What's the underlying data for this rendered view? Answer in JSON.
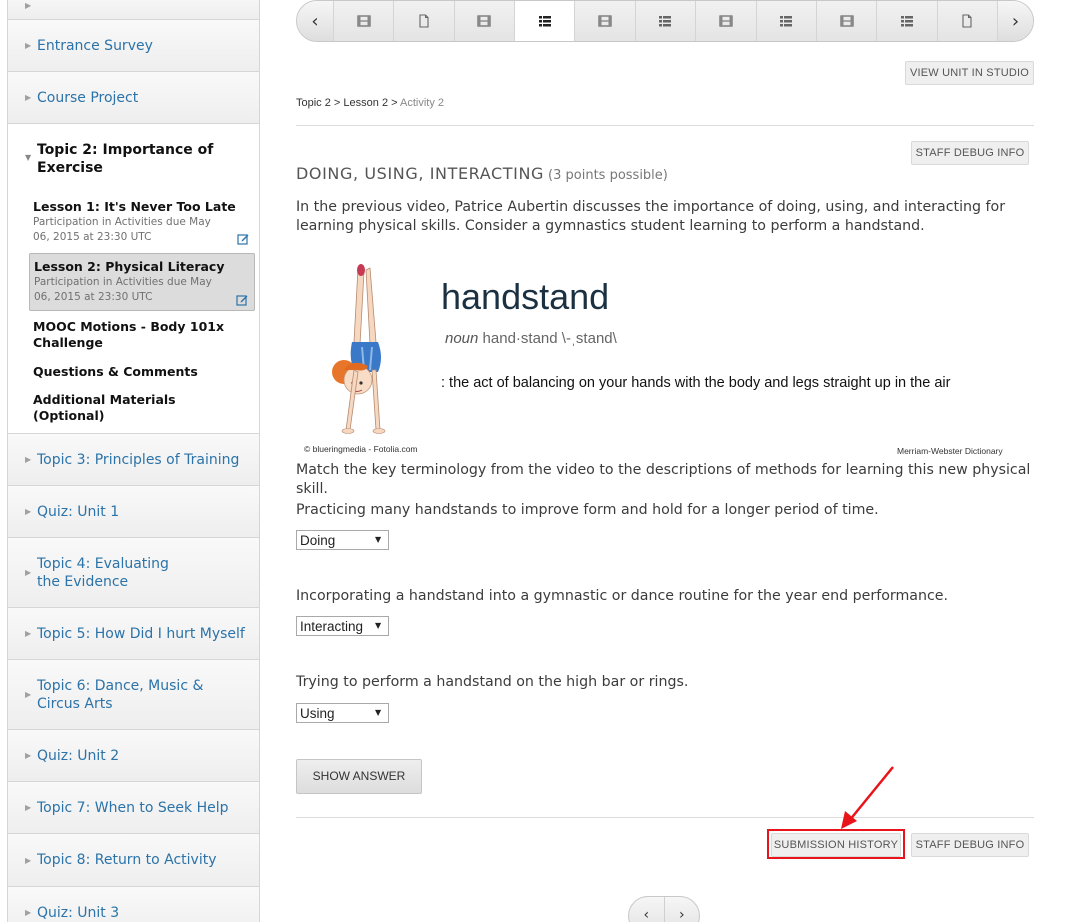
{
  "sidebar": {
    "items_top": [
      {
        "label": "Entrance Survey"
      },
      {
        "label": "Course Project"
      }
    ],
    "active_topic": {
      "title": "Topic 2: Importance of Exercise",
      "lessons": [
        {
          "title": "Lesson 1: It's Never Too Late",
          "due": "Participation in Activities due May 06, 2015 at 23:30 UTC"
        },
        {
          "title": "Lesson 2: Physical Literacy",
          "due": "Participation in Activities due May 06, 2015 at 23:30 UTC"
        }
      ],
      "links": [
        "MOOC Motions - Body 101x Challenge",
        "Questions & Comments",
        "Additional Materials (Optional)"
      ]
    },
    "items_bottom": [
      {
        "label": "Topic 3: Principles of Training"
      },
      {
        "label": "Quiz: Unit 1"
      },
      {
        "label": "Topic 4: Evaluating the Evidence"
      },
      {
        "label": "Topic 5: How Did I hurt Myself"
      },
      {
        "label": "Topic 6: Dance, Music & Circus Arts"
      },
      {
        "label": "Quiz: Unit 2"
      },
      {
        "label": "Topic 7: When to Seek Help"
      },
      {
        "label": "Topic 8: Return to Activity"
      },
      {
        "label": "Quiz: Unit 3"
      }
    ]
  },
  "unit_nav": {
    "prev": "‹",
    "next": "›",
    "tabs": [
      "video-icon",
      "page-icon",
      "video-icon",
      "problem-icon",
      "video-icon",
      "problem-icon",
      "video-icon",
      "problem-icon",
      "video-icon",
      "problem-icon",
      "page-icon"
    ],
    "active_index": 3
  },
  "view_unit_label": "VIEW UNIT IN STUDIO",
  "breadcrumb": {
    "topic": "Topic 2",
    "sep": ">",
    "lesson": "Lesson 2",
    "activity": "Activity 2"
  },
  "staff_debug_label": "STAFF DEBUG INFO",
  "problem": {
    "title": "DOING, USING, INTERACTING",
    "points": "(3 points possible)",
    "intro": "In the previous video, Patrice Aubertin discusses the importance of doing, using, and interacting for learning physical skills. Consider a gymnastics student learning to perform a handstand.",
    "illustration": {
      "word": "handstand",
      "pos": "noun",
      "pron": "hand·stand \\-ˌstand\\",
      "definition": ": the act of balancing on your hands with the body and legs straight up in the air",
      "credit_left": "© blueringmedia - Fotolia.com",
      "credit_right": "Merriam-Webster Dictionary"
    },
    "instruction": "Match the key terminology from the video to the descriptions of methods for learning this new physical skill.",
    "questions": [
      {
        "text": "Practicing many handstands to improve form and hold for a longer period of time.",
        "selected": "Doing"
      },
      {
        "text": "Incorporating a handstand into a gymnastic or dance routine for the year end performance.",
        "selected": "Interacting"
      },
      {
        "text": "Trying to perform a handstand on the high bar or rings.",
        "selected": "Using"
      }
    ],
    "show_answer_label": "SHOW ANSWER",
    "submission_history_label": "SUBMISSION HISTORY"
  },
  "bottom_nav": {
    "prev": "‹",
    "next": "›"
  },
  "colors": {
    "link": "#2b73a8",
    "highlight": "#e8141a"
  }
}
